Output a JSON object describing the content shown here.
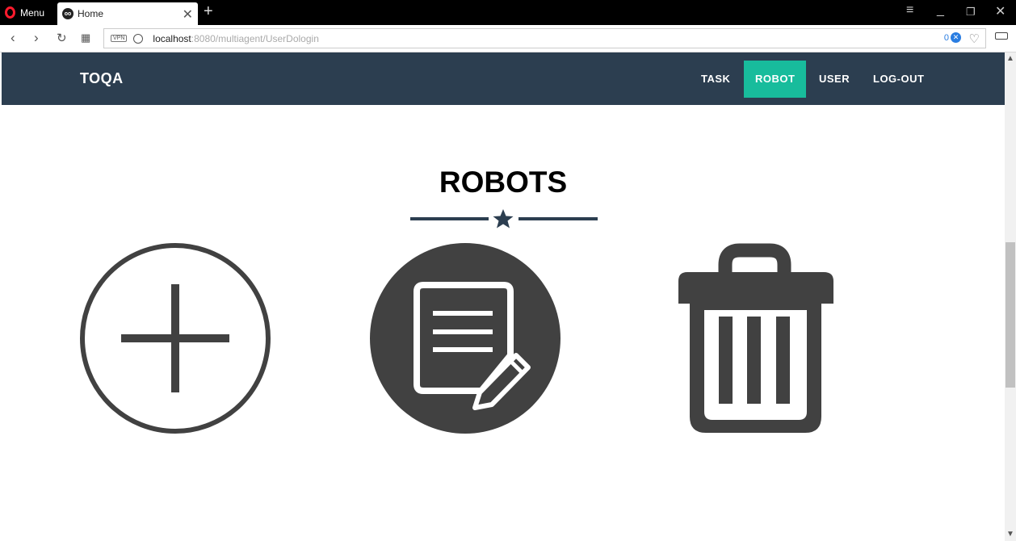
{
  "browser": {
    "menu_label": "Menu",
    "tab_title": "Home",
    "url_host": "localhost",
    "url_path": ":8080/multiagent/UserDologin",
    "vpn_label": "VPN",
    "adblock_count": "0",
    "icons": [
      "back-icon",
      "forward-icon",
      "reload-icon",
      "speed-dial-icon",
      "globe-icon",
      "heart-icon",
      "battery-icon",
      "close-icon"
    ]
  },
  "navbar": {
    "brand": "TOQA",
    "items": [
      {
        "label": "TASK",
        "active": false
      },
      {
        "label": "ROBOT",
        "active": true
      },
      {
        "label": "USER",
        "active": false
      },
      {
        "label": "LOG-OUT",
        "active": false
      }
    ],
    "bg_color": "#2c3e50",
    "active_color": "#18bc9c"
  },
  "main": {
    "title": "ROBOTS",
    "actions": [
      {
        "icon": "add-circle-icon"
      },
      {
        "icon": "edit-document-icon"
      },
      {
        "icon": "trash-icon"
      }
    ],
    "icon_color": "#414141"
  }
}
